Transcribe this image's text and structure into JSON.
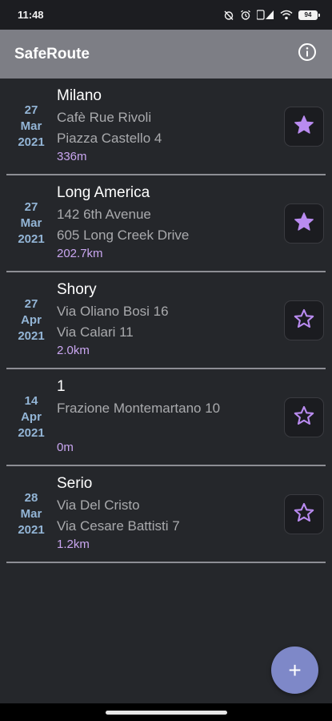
{
  "status_bar": {
    "time": "11:48",
    "battery": "94"
  },
  "app_bar": {
    "title": "SafeRoute",
    "info_icon": "info-icon"
  },
  "routes": [
    {
      "day": "27",
      "month": "Mar",
      "year": "2021",
      "name": "Milano",
      "from": "Cafè Rue Rivoli",
      "to": "Piazza Castello 4",
      "distance": "336m",
      "favorite": true
    },
    {
      "day": "27",
      "month": "Mar",
      "year": "2021",
      "name": "Long America",
      "from": "142 6th Avenue",
      "to": "605 Long Creek Drive",
      "distance": "202.7km",
      "favorite": true
    },
    {
      "day": "27",
      "month": "Apr",
      "year": "2021",
      "name": "Shory",
      "from": "Via Oliano Bosi 16",
      "to": "Via Calari 11",
      "distance": "2.0km",
      "favorite": false
    },
    {
      "day": "14",
      "month": "Apr",
      "year": "2021",
      "name": "1",
      "from": "Frazione Montemartano 10",
      "to": "",
      "distance": "0m",
      "favorite": false
    },
    {
      "day": "28",
      "month": "Mar",
      "year": "2021",
      "name": "Serio",
      "from": "Via Del Cristo",
      "to": "Via Cesare Battisti 7",
      "distance": "1.2km",
      "favorite": false
    }
  ],
  "fab": {
    "label": "+"
  },
  "colors": {
    "background": "#25272b",
    "app_bar": "#7d7e85",
    "date": "#93b5d6",
    "distance": "#c9a6f0",
    "star": "#b98bf0",
    "fab": "#7e88c8"
  }
}
